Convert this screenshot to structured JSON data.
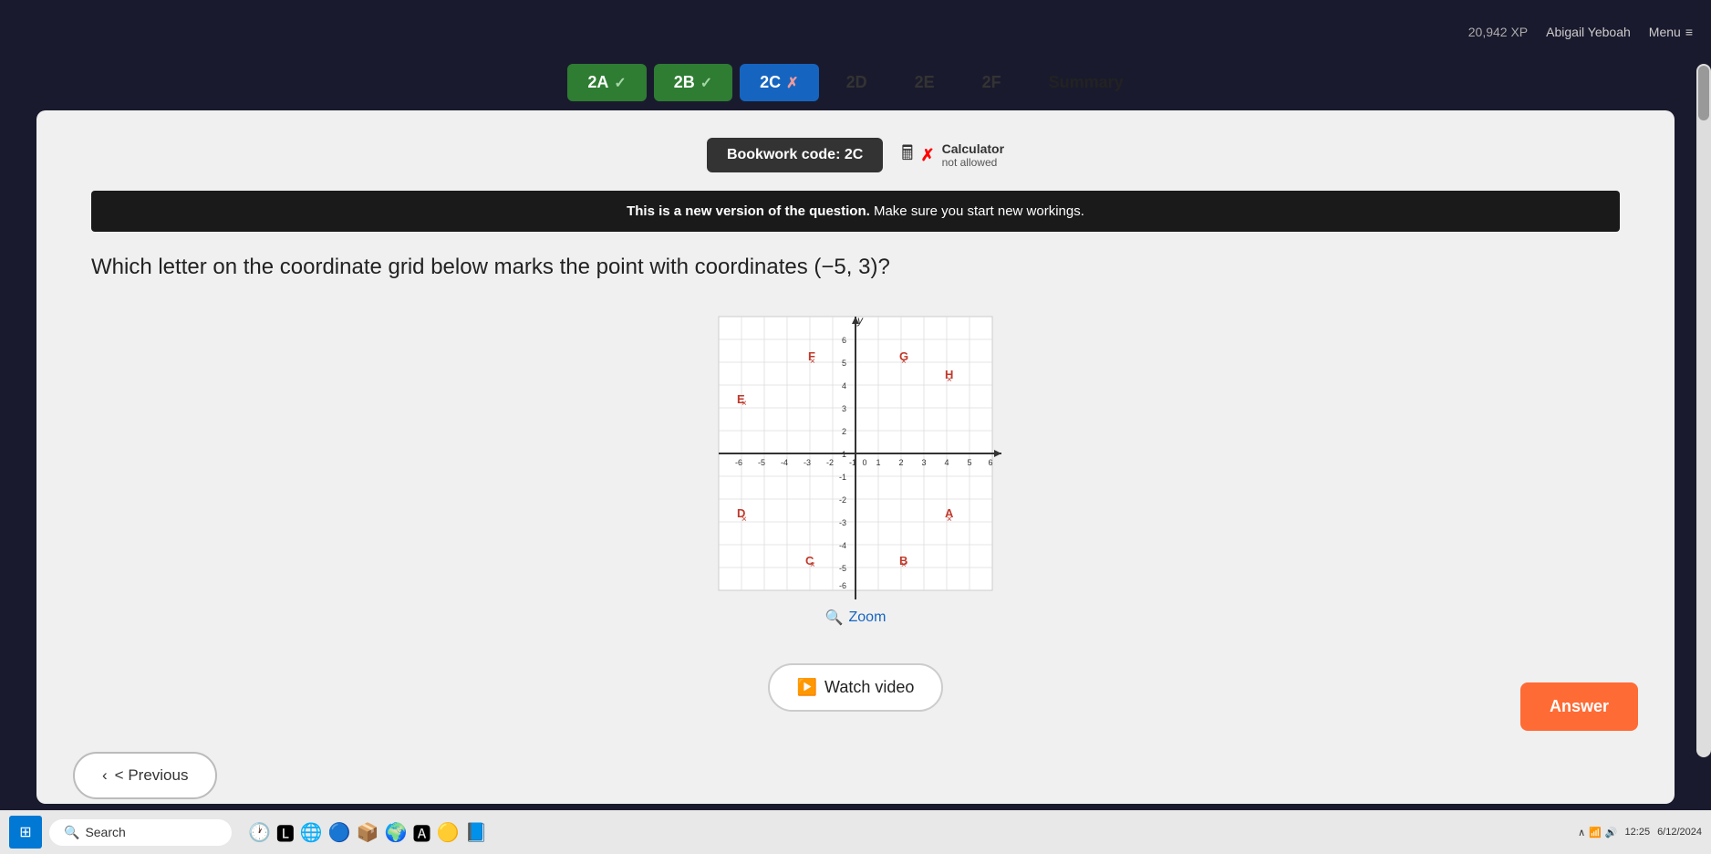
{
  "topbar": {
    "xp": "20,942 XP",
    "username": "Abigail Yeboah",
    "menu_label": "Menu"
  },
  "tabs": [
    {
      "id": "2A",
      "label": "2A",
      "state": "correct",
      "icon": "✓"
    },
    {
      "id": "2B",
      "label": "2B",
      "state": "correct",
      "icon": "✓"
    },
    {
      "id": "2C",
      "label": "2C",
      "state": "wrong",
      "icon": "✗"
    },
    {
      "id": "2D",
      "label": "2D",
      "state": "inactive"
    },
    {
      "id": "2E",
      "label": "2E",
      "state": "inactive"
    },
    {
      "id": "2F",
      "label": "2F",
      "state": "inactive"
    },
    {
      "id": "summary",
      "label": "Summary",
      "state": "summary"
    }
  ],
  "bookwork": {
    "code_label": "Bookwork code: 2C",
    "calculator_label": "Calculator",
    "calculator_sub": "not allowed"
  },
  "warning": {
    "bold_text": "This is a new version of the question.",
    "rest_text": " Make sure you start new workings."
  },
  "question": {
    "text": "Which letter on the coordinate grid below marks the point with coordinates (−5, 3)?"
  },
  "grid_points": [
    {
      "label": "F",
      "x": -2,
      "y": 5
    },
    {
      "label": "G",
      "x": 2,
      "y": 5
    },
    {
      "label": "H",
      "x": 4,
      "y": 4
    },
    {
      "label": "E",
      "x": -5,
      "y": 3
    },
    {
      "label": "D",
      "x": -5,
      "y": -3
    },
    {
      "label": "A",
      "x": 4,
      "y": -3
    },
    {
      "label": "C",
      "x": -2,
      "y": -5
    },
    {
      "label": "B",
      "x": 2,
      "y": -5
    }
  ],
  "buttons": {
    "zoom_label": "Zoom",
    "watch_video_label": "Watch video",
    "answer_label": "Answer",
    "previous_label": "< Previous"
  },
  "taskbar": {
    "search_placeholder": "Search"
  }
}
